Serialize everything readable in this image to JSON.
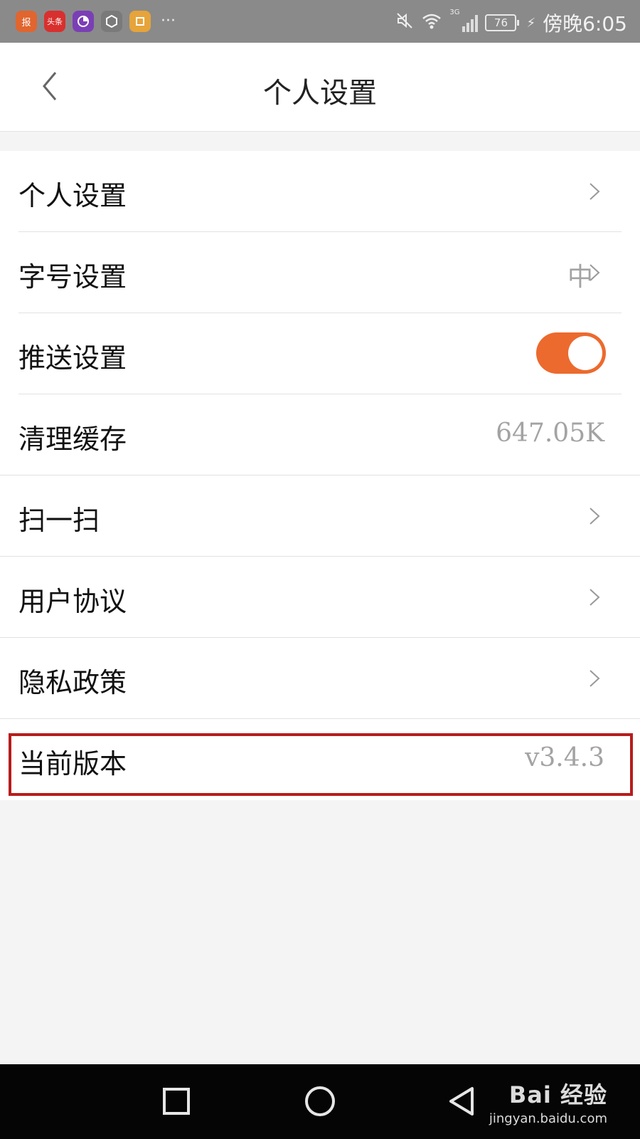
{
  "status_bar": {
    "apps": [
      {
        "icon": "newspaper-app-icon",
        "text": "报",
        "color": "#e1652f"
      },
      {
        "icon": "toutiao-app-icon",
        "text": "头条",
        "color": "#d8302e"
      },
      {
        "icon": "purple-app-icon",
        "text": "",
        "color": "#7b3fb5"
      },
      {
        "icon": "hand-app-icon",
        "text": "",
        "color": "#7a7a7a"
      },
      {
        "icon": "yellow-app-icon",
        "text": "",
        "color": "#e6a43a"
      }
    ],
    "more": "···",
    "network": "3G",
    "battery": "76",
    "time": "傍晚6:05"
  },
  "header": {
    "title": "个人设置"
  },
  "settings": [
    {
      "label": "个人设置",
      "value": "",
      "control": "chevron"
    },
    {
      "label": "字号设置",
      "value": "中",
      "control": "chevron"
    },
    {
      "label": "推送设置",
      "value": "",
      "control": "toggle",
      "toggle_on": true
    },
    {
      "label": "清理缓存",
      "value": "647.05K",
      "control": "none"
    },
    {
      "label": "扫一扫",
      "value": "",
      "control": "chevron"
    },
    {
      "label": "用户协议",
      "value": "",
      "control": "chevron"
    },
    {
      "label": "隐私政策",
      "value": "",
      "control": "chevron"
    },
    {
      "label": "当前版本",
      "value": "v3.4.3",
      "control": "none",
      "highlighted": true
    }
  ],
  "watermark": {
    "brand": "Bai 经验",
    "url": "jingyan.baidu.com"
  },
  "colors": {
    "accent": "#ec6a2e",
    "highlight_border": "#b81c1c"
  }
}
